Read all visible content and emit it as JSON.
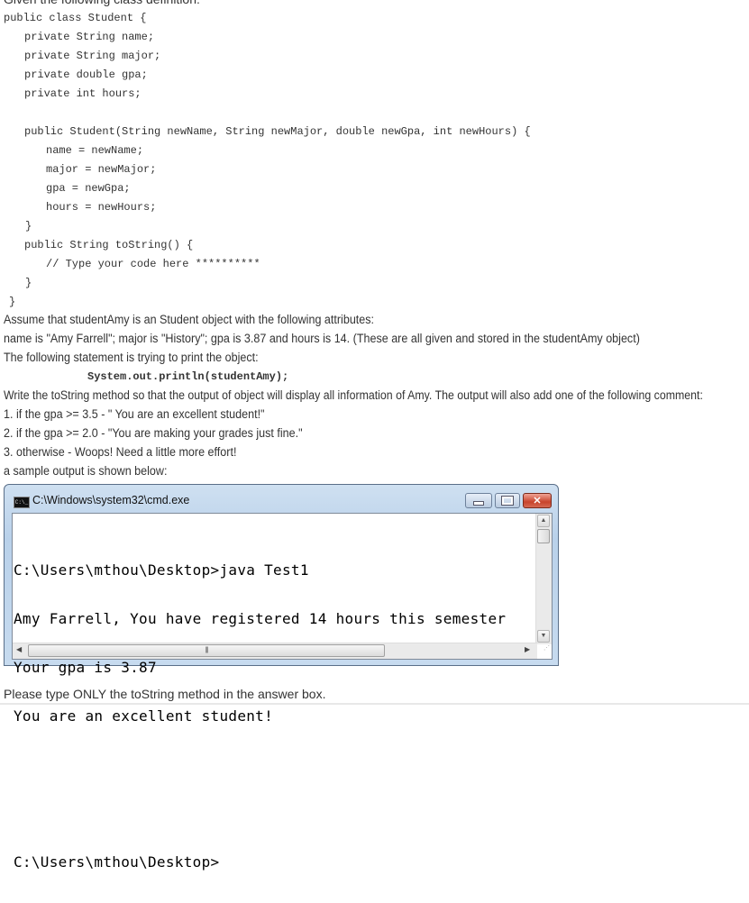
{
  "intro": "Given the following class definition:",
  "code_lines": [
    "public class Student {",
    "private String name;",
    "private String major;",
    "private double gpa;",
    "private int hours;",
    "public Student(String newName, String newMajor, double newGpa, int newHours) {",
    "name = newName;",
    "major = newMajor;",
    "gpa = newGpa;",
    "hours = newHours;",
    "}",
    "public String toString() {",
    "// Type your code here **********",
    "}",
    "}"
  ],
  "paragraphs": {
    "assume": "Assume that studentAmy is an Student object with the following attributes:",
    "attributes": "name is \"Amy Farrell\"; major is \"History\"; gpa is 3.87 and hours is 14.  (These are all given and stored in the studentAmy object)",
    "statement_intro": "The following statement is trying to print the object:",
    "statement": "System.out.println(studentAmy);",
    "write": "Write the toString method so that the output of object will display all information of Amy. The output will also add one of the following comment:",
    "rule1": "1. if the gpa >= 3.5 - \" You are an excellent student!\"",
    "rule2": "2. if the gpa >= 2.0 - \"You are making your grades just fine.\"",
    "rule3": "3. otherwise - Woops! Need a little more effort!",
    "sample": "a sample output is shown below:"
  },
  "cmd_window": {
    "title": "C:\\Windows\\system32\\cmd.exe",
    "icon_label": "C:\\_",
    "console_lines": [
      "C:\\Users\\mthou\\Desktop>java Test1",
      "Amy Farrell, You have registered 14 hours this semester",
      "Your gpa is 3.87",
      "You are an excellent student!",
      "",
      "",
      "C:\\Users\\mthou\\Desktop>"
    ],
    "close_glyph": "✕",
    "scroll_thumb_glyph": "|||",
    "up_arrow": "▲",
    "down_arrow": "▼",
    "left_arrow": "◀",
    "right_arrow": "▶",
    "grip": "⋰"
  },
  "footer": "Please type ONLY the toString method in the answer box."
}
